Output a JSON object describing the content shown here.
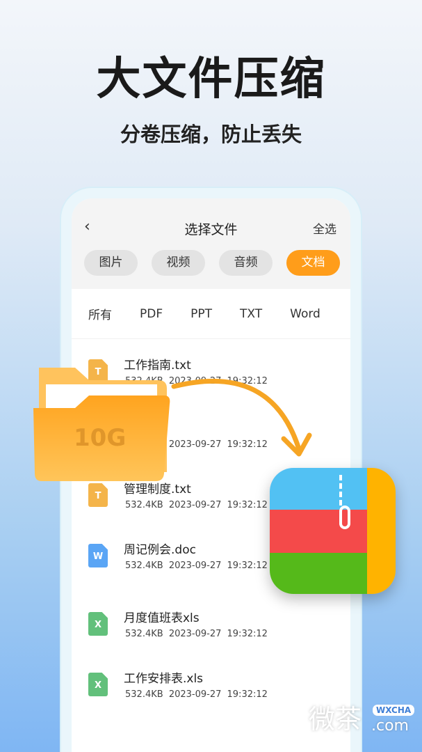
{
  "headline": "大文件压缩",
  "subtitle": "分卷压缩，防止丢失",
  "screen": {
    "title": "选择文件",
    "back_icon": "chevron-left",
    "select_all": "全选",
    "tabs": [
      {
        "label": "图片"
      },
      {
        "label": "视频"
      },
      {
        "label": "音频"
      },
      {
        "label": "文档",
        "active": true
      }
    ],
    "filters": [
      "所有",
      "PDF",
      "PPT",
      "TXT",
      "Word"
    ],
    "files": [
      {
        "name": "工作指南.txt",
        "size": "532.4KB",
        "date": "2023-09-27",
        "time": "19:32:12",
        "type": "T",
        "color": "#f4b44a"
      },
      {
        "name": "册.txt",
        "size": "532.4KB",
        "date": "2023-09-27",
        "time": "19:32:12",
        "type": "T",
        "color": "#f4b44a"
      },
      {
        "name": "管理制度.txt",
        "size": "532.4KB",
        "date": "2023-09-27",
        "time": "19:32:12",
        "type": "T",
        "color": "#f4b44a"
      },
      {
        "name": "周记例会.doc",
        "size": "532.4KB",
        "date": "2023-09-27",
        "time": "19:32:12",
        "type": "W",
        "color": "#5aa5f5"
      },
      {
        "name": "月度值班表xls",
        "size": "532.4KB",
        "date": "2023-09-27",
        "time": "19:32:12",
        "type": "X",
        "color": "#62c07b"
      },
      {
        "name": "工作安排表.xls",
        "size": "532.4KB",
        "date": "2023-09-27",
        "time": "19:32:12",
        "type": "X",
        "color": "#62c07b"
      }
    ]
  },
  "folder_label": "10G",
  "watermark": {
    "text": "微茶",
    "badge": "WXCHA",
    "domain": ".com"
  }
}
